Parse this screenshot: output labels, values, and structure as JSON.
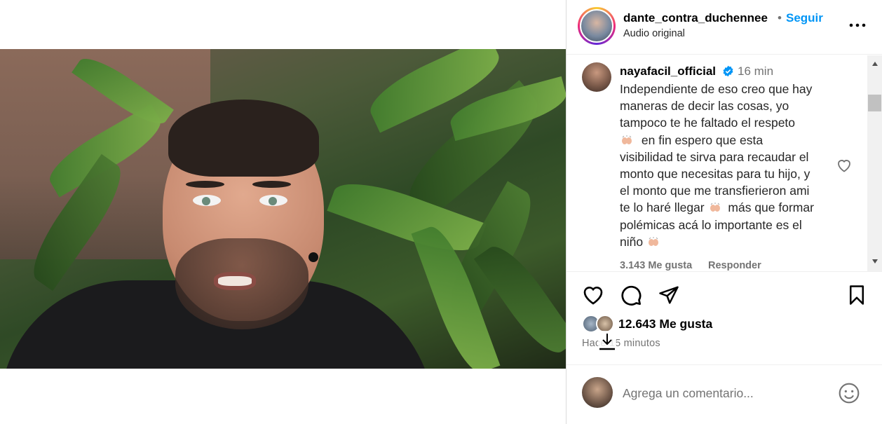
{
  "post": {
    "username": "dante_contra_duchennee",
    "dot": "•",
    "follow_label": "Seguir",
    "audio": "Audio original",
    "more_icon": "more-horizontal-icon"
  },
  "comment": {
    "username": "nayafacil_official",
    "time": "16 min",
    "lines": [
      "Independiente de eso creo que hay",
      "maneras de decir las cosas, yo",
      "tampoco te he faltado el respeto",
      "en fin espero que esta",
      "visibilidad te sirva para recaudar el",
      "monto que necesitas para tu hijo, y",
      "el monto que me transfierieron ami",
      "te lo haré llegar",
      "más que formar",
      "polémicas acá lo importante es el",
      "niño"
    ],
    "likes": "3.143 Me gusta",
    "reply_label": "Responder"
  },
  "stats": {
    "likes": "12.643 Me gusta",
    "time_ago": "Hace 15 minutos"
  },
  "composer": {
    "placeholder": "Agrega un comentario..."
  },
  "colors": {
    "accent": "#0095f6",
    "muted": "#737373"
  }
}
